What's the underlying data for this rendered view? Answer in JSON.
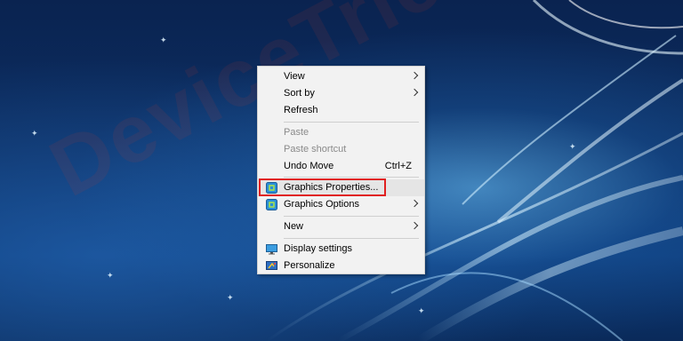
{
  "watermark": "DeviceTricks",
  "menu": {
    "items": [
      {
        "label": "View",
        "submenu": true
      },
      {
        "label": "Sort by",
        "submenu": true
      },
      {
        "label": "Refresh"
      },
      {
        "label": "Paste",
        "disabled": true
      },
      {
        "label": "Paste shortcut",
        "disabled": true
      },
      {
        "label": "Undo Move",
        "shortcut": "Ctrl+Z"
      },
      {
        "label": "Graphics Properties...",
        "icon": "intel-graphics-icon",
        "highlighted": true
      },
      {
        "label": "Graphics Options",
        "icon": "intel-graphics-icon",
        "submenu": true
      },
      {
        "label": "New",
        "submenu": true
      },
      {
        "label": "Display settings",
        "icon": "display-icon"
      },
      {
        "label": "Personalize",
        "icon": "personalize-icon"
      }
    ]
  },
  "colors": {
    "highlight_border": "#e02020",
    "menu_bg": "#f2f2f2",
    "disabled_text": "#8a8a8a"
  }
}
